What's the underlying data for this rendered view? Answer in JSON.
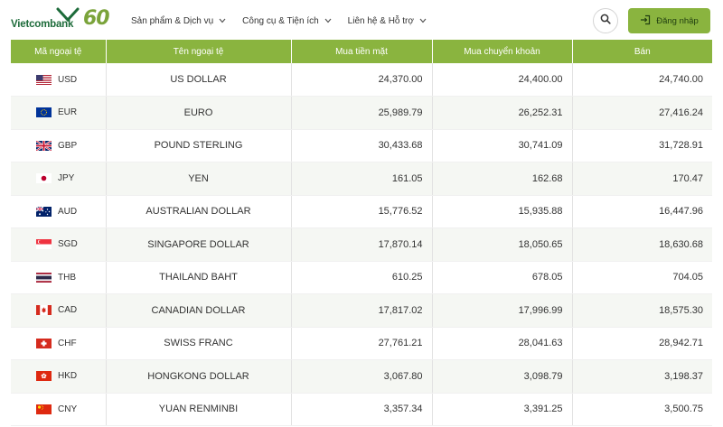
{
  "header": {
    "logo_text": "Vietcombank",
    "logo_badge": "60",
    "nav": [
      {
        "label": "Sản phẩm & Dịch vụ"
      },
      {
        "label": "Công cụ & Tiện ích"
      },
      {
        "label": "Liên hệ & Hỗ trợ"
      }
    ],
    "login_label": "Đăng nhập"
  },
  "table": {
    "columns": [
      "Mã ngoại tệ",
      "Tên ngoại tệ",
      "Mua tiền mặt",
      "Mua chuyển khoản",
      "Bán"
    ],
    "rows": [
      {
        "code": "USD",
        "name": "US DOLLAR",
        "cash": "24,370.00",
        "transfer": "24,400.00",
        "sell": "24,740.00",
        "flag": "us-flag-icon"
      },
      {
        "code": "EUR",
        "name": "EURO",
        "cash": "25,989.79",
        "transfer": "26,252.31",
        "sell": "27,416.24",
        "flag": "eu-flag-icon"
      },
      {
        "code": "GBP",
        "name": "POUND STERLING",
        "cash": "30,433.68",
        "transfer": "30,741.09",
        "sell": "31,728.91",
        "flag": "uk-flag-icon"
      },
      {
        "code": "JPY",
        "name": "YEN",
        "cash": "161.05",
        "transfer": "162.68",
        "sell": "170.47",
        "flag": "jp-flag-icon"
      },
      {
        "code": "AUD",
        "name": "AUSTRALIAN DOLLAR",
        "cash": "15,776.52",
        "transfer": "15,935.88",
        "sell": "16,447.96",
        "flag": "au-flag-icon"
      },
      {
        "code": "SGD",
        "name": "SINGAPORE DOLLAR",
        "cash": "17,870.14",
        "transfer": "18,050.65",
        "sell": "18,630.68",
        "flag": "sg-flag-icon"
      },
      {
        "code": "THB",
        "name": "THAILAND BAHT",
        "cash": "610.25",
        "transfer": "678.05",
        "sell": "704.05",
        "flag": "th-flag-icon"
      },
      {
        "code": "CAD",
        "name": "CANADIAN DOLLAR",
        "cash": "17,817.02",
        "transfer": "17,996.99",
        "sell": "18,575.30",
        "flag": "ca-flag-icon"
      },
      {
        "code": "CHF",
        "name": "SWISS FRANC",
        "cash": "27,761.21",
        "transfer": "28,041.63",
        "sell": "28,942.71",
        "flag": "ch-flag-icon"
      },
      {
        "code": "HKD",
        "name": "HONGKONG DOLLAR",
        "cash": "3,067.80",
        "transfer": "3,098.79",
        "sell": "3,198.37",
        "flag": "hk-flag-icon"
      },
      {
        "code": "CNY",
        "name": "YUAN RENMINBI",
        "cash": "3,357.34",
        "transfer": "3,391.25",
        "sell": "3,500.75",
        "flag": "cn-flag-icon"
      }
    ]
  },
  "colors": {
    "accent": "#8ab43f",
    "brand_dark": "#1d6b3a"
  }
}
